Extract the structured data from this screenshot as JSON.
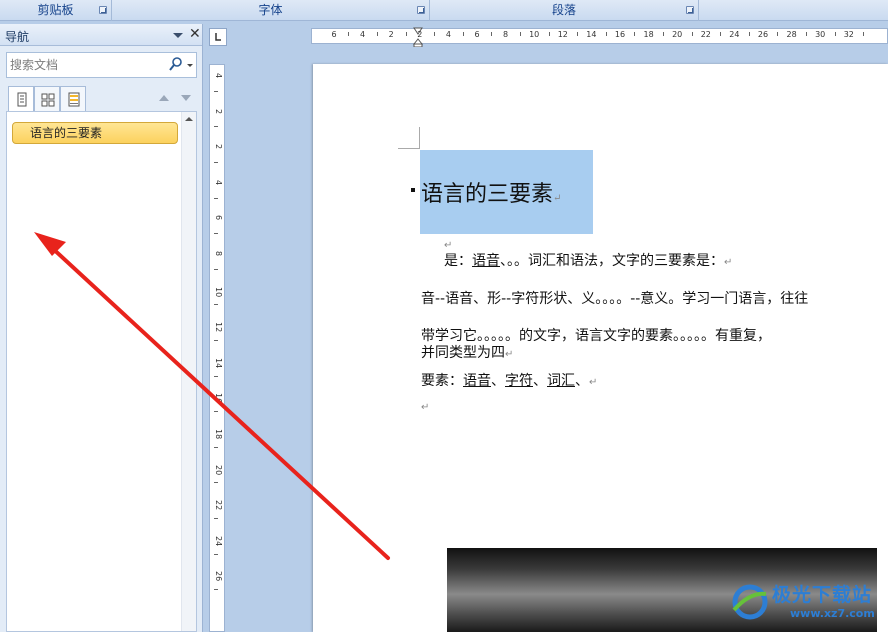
{
  "ribbon": {
    "groups": [
      {
        "label": "剪贴板"
      },
      {
        "label": "字体"
      },
      {
        "label": "段落"
      }
    ]
  },
  "nav_pane": {
    "title": "导航",
    "close_glyph": "✕",
    "search": {
      "placeholder": "搜索文档",
      "icon": "search-icon"
    },
    "tabs": [
      {
        "icon": "headings-view-icon",
        "active": true
      },
      {
        "icon": "pages-view-icon",
        "active": false
      },
      {
        "icon": "results-view-icon",
        "active": false
      }
    ],
    "headings": [
      {
        "label": "语言的三要素",
        "selected": true
      }
    ]
  },
  "ruler": {
    "h_labels": [
      "6",
      "4",
      "2",
      "2",
      "4",
      "6",
      "8",
      "10",
      "12",
      "14",
      "16",
      "18",
      "20",
      "22",
      "24",
      "26",
      "28",
      "30",
      "32"
    ],
    "v_labels": [
      "4",
      "2",
      "2",
      "4",
      "6",
      "8",
      "10",
      "12",
      "14",
      "16",
      "18",
      "20",
      "22",
      "24",
      "26"
    ]
  },
  "document": {
    "title": "语言的三要素",
    "paragraphs": {
      "p1_prefix": "是：",
      "p1_u1": "语音",
      "p1_rest": "、。。词汇和语法，文字的三要素是：",
      "p2": "音--语音、形--字符形状、义。。。。--意义。学习一门语言，往往",
      "p3": "带学习它。。。。。的文字，语言文字的要素。。。。。有重复，",
      "p3b": "并同类型为四",
      "p4_prefix": "要素：",
      "p4_u1": "语音",
      "p4_sep1": "、",
      "p4_u2": "字符",
      "p4_sep2": "、",
      "p4_u3": "词汇",
      "p4_end": "、"
    },
    "para_mark": "↵"
  },
  "annotation": {
    "arrow_color": "#e8231c"
  },
  "watermark": {
    "text": "极光下载站",
    "url": "www.xz7.com"
  },
  "colors": {
    "selection": "#a8cdf0",
    "heading_highlight": "#fcd25e",
    "ribbon_text": "#15428b"
  }
}
